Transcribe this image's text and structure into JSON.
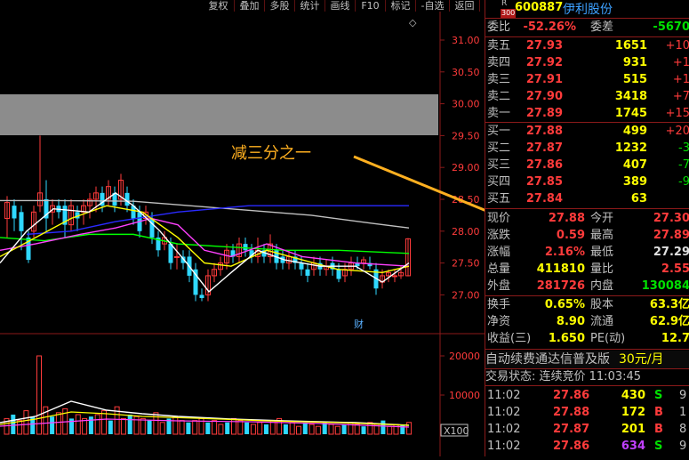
{
  "toolbar": [
    "复权",
    "叠加",
    "多股",
    "统计",
    "画线",
    "F10",
    "标记",
    "-自选",
    "返回"
  ],
  "chart": {
    "price_ticks": [
      "31.00",
      "30.50",
      "30.00",
      "29.50",
      "29.00",
      "28.50",
      "28.00",
      "27.50",
      "27.00"
    ],
    "volume_ticks": [
      "20000",
      "10000"
    ],
    "volume_unit": "X100",
    "annotation": "减三分之一",
    "event_marker": "财",
    "diamond": "◇"
  },
  "stock": {
    "r_label": "R",
    "market_code": "300",
    "code": "600887",
    "name": "伊利股份"
  },
  "ratio": {
    "label1": "委比",
    "value1": "-52.26%",
    "label2": "委差",
    "value2": "-5670"
  },
  "asks": [
    {
      "label": "卖五",
      "price": "27.93",
      "vol": "1651",
      "chg": "+10"
    },
    {
      "label": "卖四",
      "price": "27.92",
      "vol": "931",
      "chg": "+1"
    },
    {
      "label": "卖三",
      "price": "27.91",
      "vol": "515",
      "chg": "+1"
    },
    {
      "label": "卖二",
      "price": "27.90",
      "vol": "3418",
      "chg": "+7"
    },
    {
      "label": "卖一",
      "price": "27.89",
      "vol": "1745",
      "chg": "+15"
    }
  ],
  "bids": [
    {
      "label": "买一",
      "price": "27.88",
      "vol": "499",
      "chg": "+20"
    },
    {
      "label": "买二",
      "price": "27.87",
      "vol": "1232",
      "chg": "-3"
    },
    {
      "label": "买三",
      "price": "27.86",
      "vol": "407",
      "chg": "-7"
    },
    {
      "label": "买四",
      "price": "27.85",
      "vol": "389",
      "chg": "-9"
    },
    {
      "label": "买五",
      "price": "27.84",
      "vol": "63",
      "chg": ""
    }
  ],
  "quote": [
    {
      "l1": "现价",
      "v1": "27.88",
      "c1": "red",
      "l2": "今开",
      "v2": "27.30",
      "c2": "red"
    },
    {
      "l1": "涨跌",
      "v1": "0.59",
      "c1": "red",
      "l2": "最高",
      "v2": "27.89",
      "c2": "red"
    },
    {
      "l1": "涨幅",
      "v1": "2.16%",
      "c1": "red",
      "l2": "最低",
      "v2": "27.29",
      "c2": "white"
    },
    {
      "l1": "总量",
      "v1": "411810",
      "c1": "yellow",
      "l2": "量比",
      "v2": "2.55",
      "c2": "red"
    },
    {
      "l1": "外盘",
      "v1": "281726",
      "c1": "red",
      "l2": "内盘",
      "v2": "130084",
      "c2": "green"
    }
  ],
  "fundamentals": [
    {
      "l1": "换手",
      "v1": "0.65%",
      "l2": "股本",
      "v2": "63.3亿"
    },
    {
      "l1": "净资",
      "v1": "8.90",
      "l2": "流通",
      "v2": "62.9亿"
    },
    {
      "l1": "收益(三)",
      "v1": "1.650",
      "l2": "PE(动)",
      "v2": "12.7"
    }
  ],
  "ad": {
    "text": "自动续费通达信普及版",
    "price": "30元/月"
  },
  "status": "交易状态: 连续竞价 11:03:45",
  "trades": [
    {
      "time": "11:02",
      "price": "27.86",
      "vol": "430",
      "side": "S",
      "n": "9"
    },
    {
      "time": "11:02",
      "price": "27.88",
      "vol": "172",
      "side": "B",
      "n": "1"
    },
    {
      "time": "11:02",
      "price": "27.87",
      "vol": "201",
      "side": "B",
      "n": "8"
    },
    {
      "time": "11:02",
      "price": "27.86",
      "vol": "634",
      "side": "S",
      "n": "9"
    }
  ],
  "colors": {
    "up": "#ff3b3b",
    "down": "#00e000",
    "grid": "#8b1a1a",
    "ma5": "#ffffff",
    "ma10": "#ffff00",
    "ma20": "#ff40ff",
    "ma30": "#00ff00",
    "ma60": "#c0c0c0",
    "ma120": "#2a2aff",
    "arrow": "#ffb020"
  }
}
